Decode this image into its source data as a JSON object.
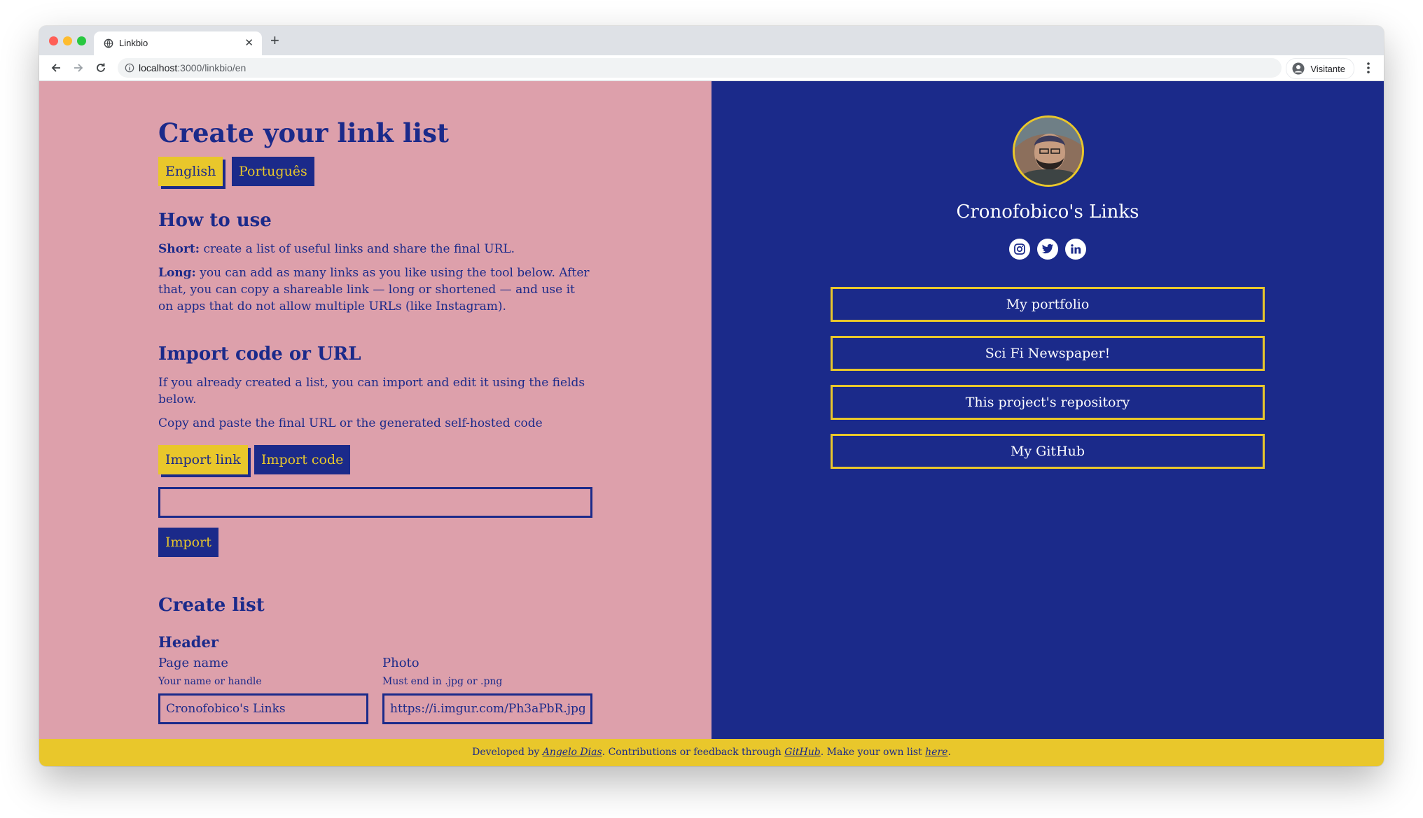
{
  "browser": {
    "tab_title": "Linkbio",
    "url_host": "localhost",
    "url_path": ":3000/linkbio/en",
    "profile_label": "Visitante"
  },
  "left": {
    "title": "Create your link list",
    "lang_english": "English",
    "lang_portuguese": "Português",
    "how_to_use": {
      "heading": "How to use",
      "short_label": "Short:",
      "short_text": " create a list of useful links and share the final URL.",
      "long_label": "Long:",
      "long_text": " you can add as many links as you like using the tool below. After that, you can copy a shareable link — long or shortened — and use it on apps that do not allow multiple URLs (like Instagram)."
    },
    "import": {
      "heading": "Import code or URL",
      "para1": "If you already created a list, you can import and edit it using the fields below.",
      "para2": "Copy and paste the final URL or the generated self-hosted code",
      "btn_import_link": "Import link",
      "btn_import_code": "Import code",
      "input_value": "",
      "btn_import": "Import"
    },
    "create": {
      "heading": "Create list",
      "subheading": "Header",
      "page_name_label": "Page name",
      "page_name_hint": "Your name or handle",
      "page_name_value": "Cronofobico's Links",
      "photo_label": "Photo",
      "photo_hint": "Must end in .jpg or .png",
      "photo_value": "https://i.imgur.com/Ph3aPbR.jpg"
    }
  },
  "right": {
    "page_name": "Cronofobico's Links",
    "social_icons": [
      "instagram-icon",
      "twitter-icon",
      "linkedin-icon"
    ],
    "links": [
      "My portfolio",
      "Sci Fi Newspaper!",
      "This project's repository",
      "My GitHub"
    ]
  },
  "footer": {
    "t1": "Developed by ",
    "author": "Angelo Dias",
    "t2": ". Contributions or feedback through ",
    "github": "GitHub",
    "t3": ". Make your own list ",
    "here": "here",
    "t4": "."
  },
  "colors": {
    "navy": "#1b2a8a",
    "pink": "#dda0ab",
    "yellow": "#e9c72b"
  }
}
